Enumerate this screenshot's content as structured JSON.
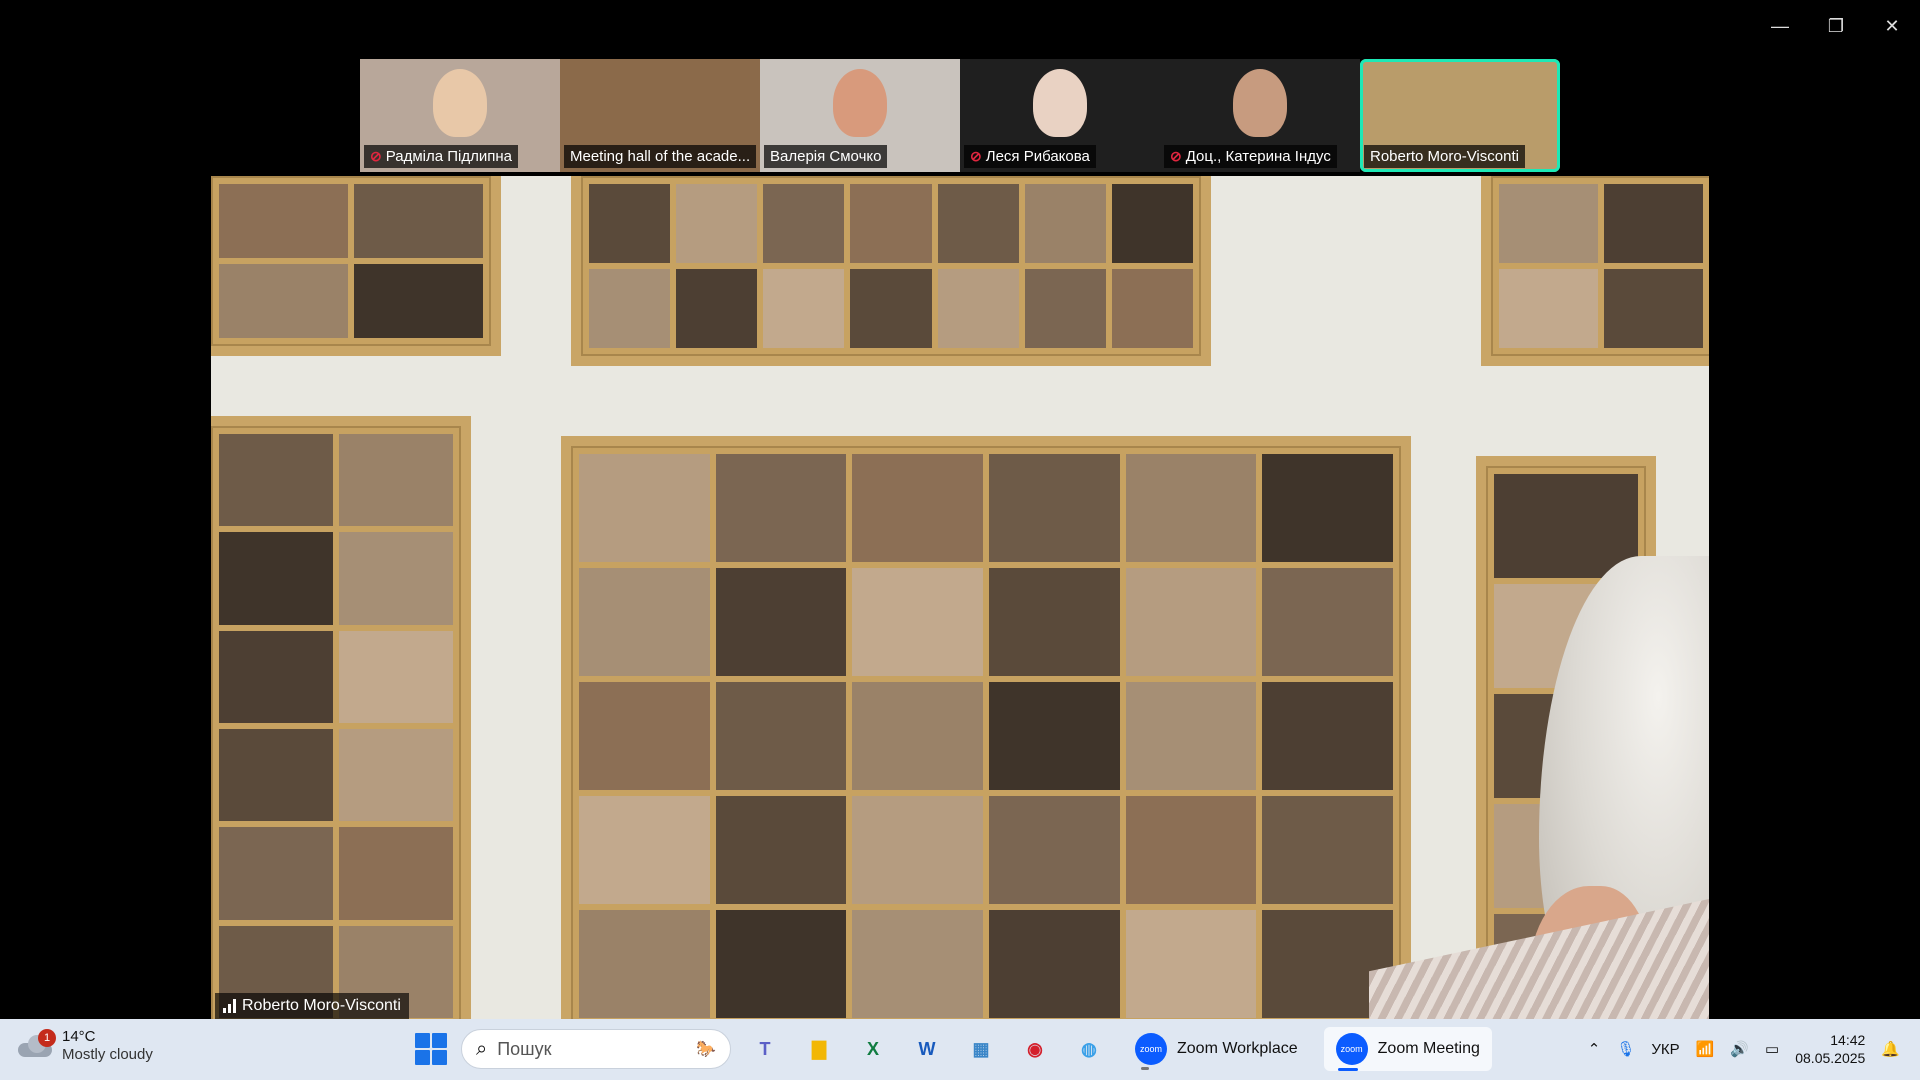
{
  "window": {
    "controls": [
      {
        "name": "minimize-icon",
        "glyph": "—"
      },
      {
        "name": "restore-icon",
        "glyph": "❐"
      },
      {
        "name": "close-icon",
        "glyph": "✕"
      }
    ]
  },
  "participants": [
    {
      "name": "Радміла Підлипна",
      "muted": true,
      "bg": "#b8a79a",
      "face": "#e8c8a8"
    },
    {
      "name": "Meeting hall of the acade...",
      "muted": false,
      "bg": "#8b6a4a",
      "face": null
    },
    {
      "name": "Валерія Смочко",
      "muted": false,
      "bg": "#c9c3bd",
      "face": "#d89a7c"
    },
    {
      "name": "Леся Рибакова",
      "muted": true,
      "bg": "#1f1f1f",
      "face": "#e9d2c3"
    },
    {
      "name": "Доц., Катерина Індус",
      "muted": true,
      "bg": "#1f1f1f",
      "face": "#c79b7f"
    },
    {
      "name": "Roberto Moro-Visconti",
      "muted": false,
      "bg": "#b99c6a",
      "face": null,
      "active": true
    }
  ],
  "main_video": {
    "speaker": "Roberto Moro-Visconti"
  },
  "taskbar": {
    "weather": {
      "badge": "1",
      "temp": "14°C",
      "condition": "Mostly cloudy"
    },
    "search_placeholder": "Пошук",
    "apps": [
      {
        "name": "teams-icon",
        "glyph": "T",
        "color": "#5b5fc7"
      },
      {
        "name": "file-explorer-icon",
        "glyph": "▇",
        "color": "#f2b705"
      },
      {
        "name": "excel-icon",
        "glyph": "X",
        "color": "#107c41"
      },
      {
        "name": "word-icon",
        "glyph": "W",
        "color": "#185abd"
      },
      {
        "name": "control-panel-icon",
        "glyph": "▦",
        "color": "#3a86c8"
      },
      {
        "name": "acrobat-icon",
        "glyph": "◉",
        "color": "#d4202c"
      },
      {
        "name": "paint-icon",
        "glyph": "◍",
        "color": "#3aa0e8"
      }
    ],
    "zoom_workplace": "Zoom Workplace",
    "zoom_meeting": "Zoom Meeting",
    "language": "УКР",
    "time": "14:42",
    "date": "08.05.2025"
  }
}
